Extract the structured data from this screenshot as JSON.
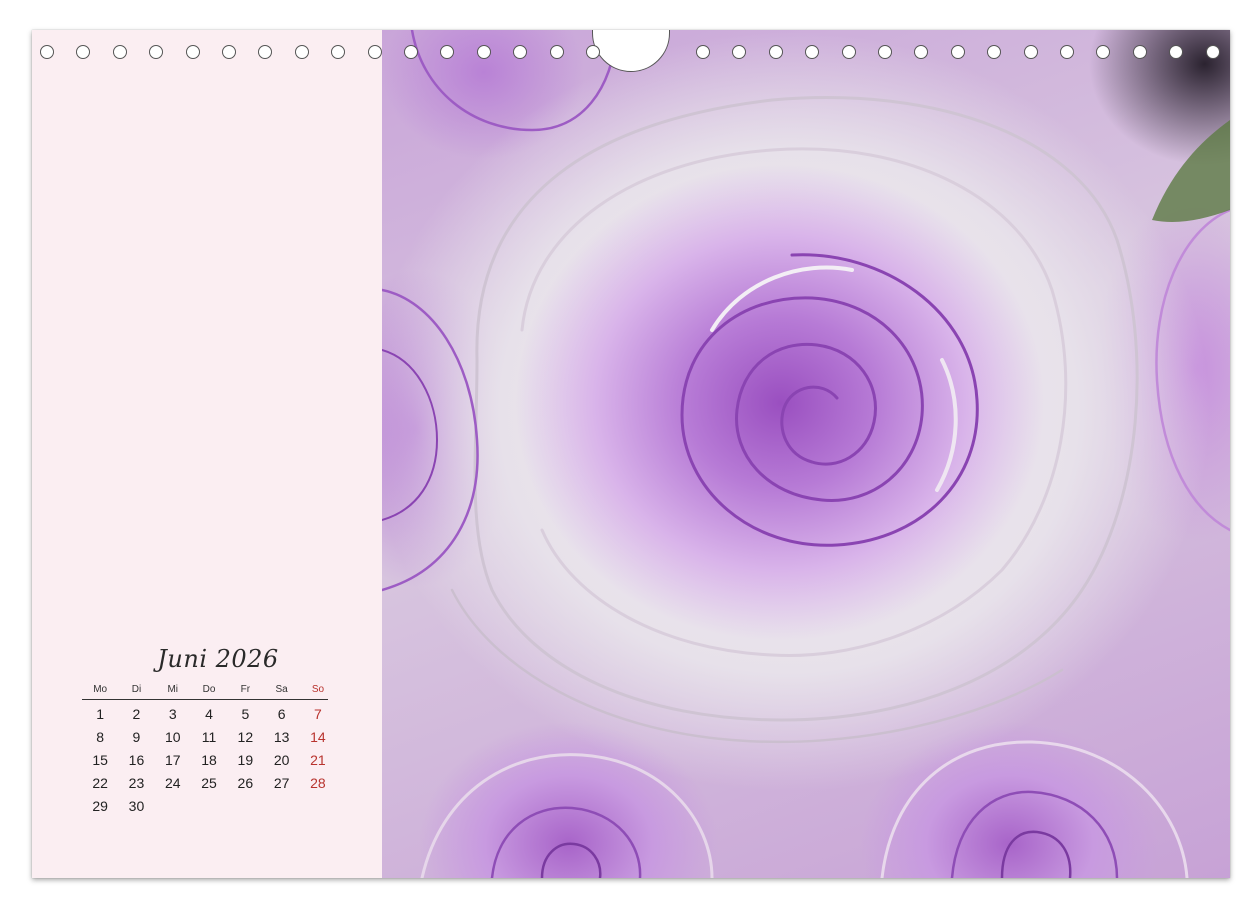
{
  "calendar": {
    "title": "Juni 2026",
    "weekdays": [
      "Mo",
      "Di",
      "Mi",
      "Do",
      "Fr",
      "Sa",
      "So"
    ],
    "weeks": [
      [
        "1",
        "2",
        "3",
        "4",
        "5",
        "6",
        "7"
      ],
      [
        "8",
        "9",
        "10",
        "11",
        "12",
        "13",
        "14"
      ],
      [
        "15",
        "16",
        "17",
        "18",
        "19",
        "20",
        "21"
      ],
      [
        "22",
        "23",
        "24",
        "25",
        "26",
        "27",
        "28"
      ],
      [
        "29",
        "30",
        "",
        "",
        "",
        "",
        ""
      ]
    ],
    "sunday_color": "#b8332e"
  },
  "photo": {
    "subject": "purple-rose-icon"
  },
  "colors": {
    "panel_background": "#fbeef2",
    "rose_accent": "#b77bd6"
  }
}
